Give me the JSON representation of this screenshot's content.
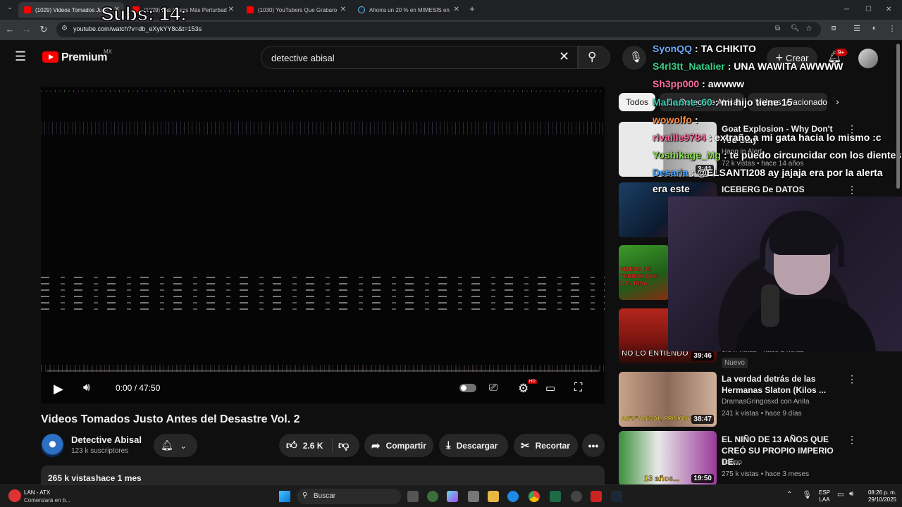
{
  "browser": {
    "tabs": [
      {
        "label": "(1029) Videos Tomados Just",
        "active": true
      },
      {
        "label": "(1029) Las Cosas Más Perturbad",
        "active": false
      },
      {
        "label": "(1030) YouTubers Que Grabaro",
        "active": false
      },
      {
        "label": "Ahorra un 20 % en MIMESIS en",
        "active": false
      }
    ],
    "url": "youtube.com/watch?v=db_eXykYY8c&t=153s"
  },
  "youtube": {
    "logo_text": "Premium",
    "logo_region": "MX",
    "search_value": "detective abisal",
    "create_label": "Crear",
    "notif_count": "9+"
  },
  "player": {
    "time": "0:00 / 47:50",
    "quality_badge": "HD",
    "progress": 0.0
  },
  "video": {
    "title": "Videos Tomados Justo Antes del Desastre Vol. 2",
    "channel": "Detective Abisal",
    "subscribers": "123 k suscriptores",
    "likes": "2.6 K",
    "share_label": "Compartir",
    "download_label": "Descargar",
    "clip_label": "Recortar",
    "views": "265 k vistas",
    "published": "hace 1 mes"
  },
  "chips": [
    "Todos",
    "De Detective Abisal",
    "Videos relacionados"
  ],
  "recommendations": [
    {
      "title": "Goat Explosion - Why Don't You Stay",
      "channel": "Hang in Alert",
      "meta": "72 k vistas • hace 14 años",
      "duration": "3:41",
      "badge": ""
    },
    {
      "title": "ICEBERG De DATOS PERTURBADORES 2",
      "channel": "",
      "meta": "",
      "duration": "",
      "badge": ""
    },
    {
      "title": "",
      "channel": "",
      "meta": "",
      "duration": "",
      "badge": ""
    },
    {
      "title": "",
      "channel": "",
      "meta": "6.6 k vistas • hace 3 horas",
      "duration": "39:46",
      "badge": "Nuevo"
    },
    {
      "title": "La verdad detrás de las Hermanas Slaton (Kilos ...",
      "channel": "DramasGringosxd con Anita",
      "meta": "241 k vistas • hace 9 días",
      "duration": "38:47",
      "badge": ""
    },
    {
      "title": "EL NIÑO DE 13 AÑOS QUE CREÓ SU PROPIO IMPERIO DE...",
      "channel": "Tocino",
      "meta": "275 k vistas • hace 3 meses",
      "duration": "19:50",
      "badge": ""
    }
  ],
  "thumb_texts": {
    "rec3": "VIDEOS DE TERROR QUE DAN RISA",
    "rec4": "NO LO ENTIENDO",
    "rec5": "AB*S* ANIMAL, PRISIÓN Y ...",
    "rec6": "13 años..."
  },
  "overlay": {
    "subs": "Subs: 14:",
    "chat": [
      {
        "user": "SyonQQ",
        "msg": ": TA CHIKITO",
        "color": "#6fa8ff"
      },
      {
        "user": "S4rl3tt_Natalier",
        "msg": ": UNA WAWITA AWWWW",
        "color": "#37d18a"
      },
      {
        "user": "Sh3pp000",
        "msg": ": awwww",
        "color": "#ff6f9e"
      },
      {
        "user": "Marianne_60",
        "msg": ": mi hijo tiene 15",
        "color": "#37d1b8"
      },
      {
        "user": "wowolfo",
        "msg": ":",
        "color": "#ff8a3d"
      },
      {
        "user": "rivaille9784",
        "msg": ": extraño a mi gata hacia lo mismo :c",
        "color": "#ff6f9e"
      },
      {
        "user": "Yoshikage_Mg",
        "msg": ": te puedo circuncidar con los dientes?",
        "color": "#8be04e"
      },
      {
        "user": "Desaria",
        "msg": ": @ELSANTI208 ay jajaja era por la alerta",
        "color": "#4aa3ff"
      },
      {
        "user": "",
        "msg": "era este",
        "color": "#ffffff"
      }
    ]
  },
  "taskbar": {
    "network": "LAN - ATX",
    "network_status": "Comenzará en b...",
    "search": "Buscar",
    "lang1": "ESP",
    "lang2": "LAA",
    "time": "08:26 p. m.",
    "date": "29/10/2025"
  }
}
